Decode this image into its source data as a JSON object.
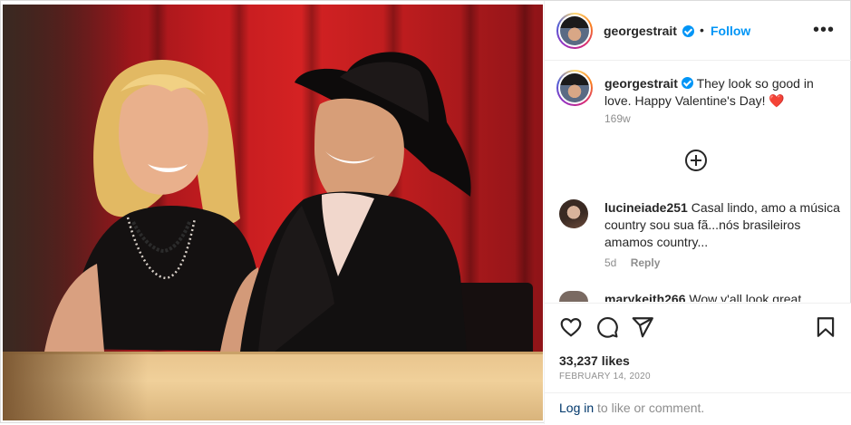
{
  "post": {
    "author": "georgestrait",
    "follow_label": "Follow",
    "separator": "•",
    "more_icon": "more-horizontal-icon",
    "more_label": "•••"
  },
  "caption": {
    "username": "georgestrait",
    "text": "They look so good in love. Happy Valentine's Day!",
    "emoji": "❤️",
    "time": "169w"
  },
  "comments": [
    {
      "username": "lucineiade251",
      "text": "Casal lindo, amo a música country sou sua fã...nós brasileiros amamos country...",
      "age": "5d",
      "reply_label": "Reply"
    },
    {
      "username": "marykeith266",
      "text": "Wow y'all look great"
    }
  ],
  "actions": {
    "like_icon": "heart-icon",
    "comment_icon": "comment-icon",
    "share_icon": "send-icon",
    "save_icon": "bookmark-icon"
  },
  "likes": "33,237 likes",
  "date": "FEBRUARY 14, 2020",
  "login": {
    "link_label": "Log in",
    "suffix": " to like or comment."
  },
  "colors": {
    "link_blue": "#0095f6",
    "verified_blue": "#0095f6",
    "curtain_red": "#c11b1f",
    "text": "#262626",
    "muted": "#8e8e8e"
  }
}
